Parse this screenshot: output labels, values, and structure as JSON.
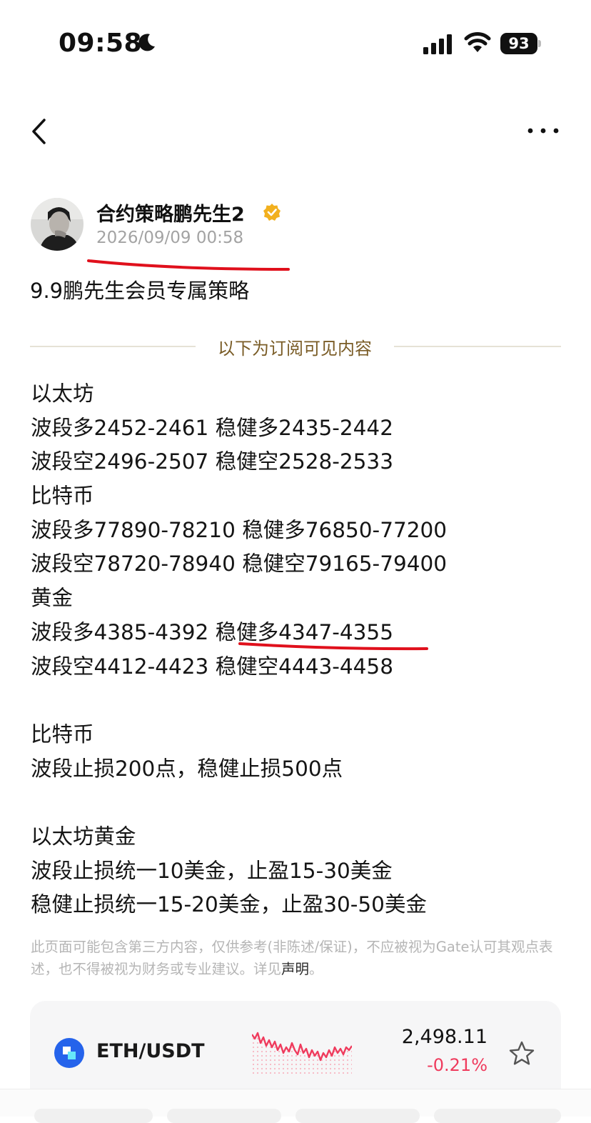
{
  "status_bar": {
    "time": "09:58",
    "battery": "93",
    "icons": [
      "moon-icon",
      "signal-icon",
      "wifi-icon",
      "battery-icon"
    ]
  },
  "nav": {
    "icons": [
      "back-icon",
      "more-icon"
    ]
  },
  "author": {
    "name": "合约策略鹏先生2",
    "timestamp": "2026/09/09 00:58",
    "badge_color": "#f2b01e"
  },
  "post": {
    "title": "9.9鹏先生会员专属策略",
    "subscription_divider": "以下为订阅可见内容",
    "lines": [
      "以太坊",
      "波段多2452-2461 稳健多2435-2442",
      "波段空2496-2507 稳健空2528-2533",
      "比特币",
      "波段多77890-78210 稳健多76850-77200",
      "波段空78720-78940 稳健空79165-79400",
      "黄金",
      "波段多4385-4392 稳健多4347-4355",
      "波段空4412-4423 稳健空4443-4458",
      "",
      "比特币",
      "波段止损200点，稳健止损500点",
      "",
      "以太坊黄金",
      "波段止损统一10美金，止盈15-30美金",
      "稳健止损统一15-20美金，止盈30-50美金"
    ],
    "disclaimer_text": "此页面可能包含第三方内容，仅供参考(非陈述/保证)，不应被视为Gate认可其观点表述，也不得被视为财务或专业建议。详见",
    "disclaimer_link": "声明",
    "disclaimer_end": "。",
    "annotation_color": "#e0101c"
  },
  "ticker": {
    "pair": "ETH/USDT",
    "price": "2,498.11",
    "change": "-0.21%",
    "change_color": "#ef3b5d",
    "icon": "eth-token-icon"
  }
}
